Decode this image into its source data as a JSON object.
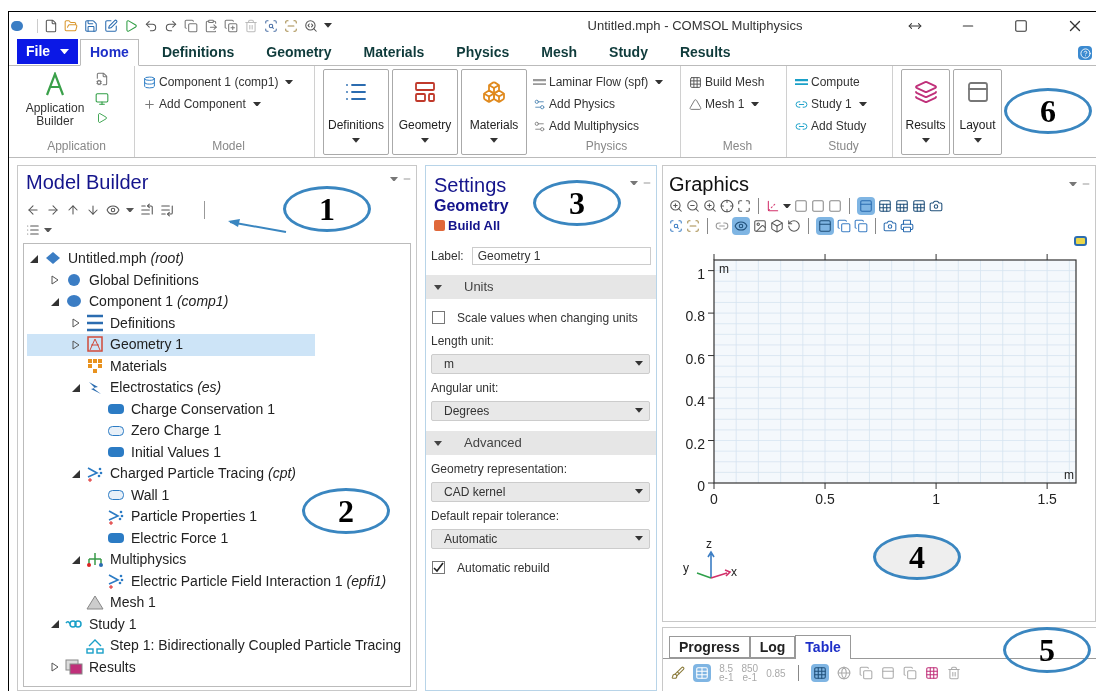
{
  "window": {
    "title": "Untitled.mph - COMSOL Multiphysics"
  },
  "ribbon_tabs": [
    {
      "label": "File",
      "kind": "file",
      "selected": false
    },
    {
      "label": "Home",
      "kind": "tab",
      "selected": true
    },
    {
      "label": "Definitions",
      "kind": "tab",
      "selected": false
    },
    {
      "label": "Geometry",
      "kind": "tab",
      "selected": false
    },
    {
      "label": "Materials",
      "kind": "tab",
      "selected": false
    },
    {
      "label": "Physics",
      "kind": "tab",
      "selected": false
    },
    {
      "label": "Mesh",
      "kind": "tab",
      "selected": false
    },
    {
      "label": "Study",
      "kind": "tab",
      "selected": false
    },
    {
      "label": "Results",
      "kind": "tab",
      "selected": false
    }
  ],
  "ribbon_groups": [
    {
      "caption": "Application",
      "items": [
        {
          "kind": "large",
          "label": "Application Builder",
          "dropdown": false
        },
        {
          "kind": "icons"
        }
      ]
    },
    {
      "caption": "Model",
      "items": [
        {
          "kind": "small",
          "label": "Component 1 (comp1)",
          "dropdown": true
        },
        {
          "kind": "small",
          "label": "Add Component",
          "dropdown": true
        }
      ]
    },
    {
      "items": [
        {
          "kind": "boxed",
          "label": "Definitions",
          "dropdown": true
        },
        {
          "kind": "boxed",
          "label": "Geometry",
          "dropdown": true
        },
        {
          "kind": "boxed",
          "label": "Materials",
          "dropdown": true
        }
      ]
    },
    {
      "caption": "Physics",
      "items": [
        {
          "kind": "small",
          "label": "Laminar Flow (spf)",
          "dropdown": true
        },
        {
          "kind": "small",
          "label": "Add Physics",
          "dropdown": false
        },
        {
          "kind": "small",
          "label": "Add Multiphysics",
          "dropdown": false
        }
      ]
    },
    {
      "caption": "Mesh",
      "items": [
        {
          "kind": "small",
          "label": "Build Mesh",
          "dropdown": false
        },
        {
          "kind": "small",
          "label": "Mesh 1",
          "dropdown": true
        }
      ]
    },
    {
      "caption": "Study",
      "items": [
        {
          "kind": "small",
          "label": "Compute",
          "dropdown": false
        },
        {
          "kind": "small",
          "label": "Study 1",
          "dropdown": true
        },
        {
          "kind": "small",
          "label": "Add Study",
          "dropdown": false
        }
      ]
    },
    {
      "items": [
        {
          "kind": "boxed",
          "label": "Results",
          "dropdown": true
        },
        {
          "kind": "boxed",
          "label": "Layout",
          "dropdown": true
        }
      ]
    }
  ],
  "model_builder": {
    "title": "Model Builder",
    "tree": [
      {
        "label": "Untitled.mph *(root)*",
        "expanded": true,
        "selected": false,
        "children": [
          {
            "label": "Global Definitions",
            "expanded": false,
            "selected": false
          },
          {
            "label": "Component 1 *(comp1)*",
            "expanded": true,
            "selected": false,
            "children": [
              {
                "label": "Definitions",
                "expanded": false,
                "selected": false
              },
              {
                "label": "Geometry 1",
                "expanded": false,
                "selected": true
              },
              {
                "label": "Materials",
                "selected": false
              },
              {
                "label": "Electrostatics *(es)*",
                "expanded": true,
                "selected": false,
                "children": [
                  {
                    "label": "Charge Conservation 1",
                    "selected": false
                  },
                  {
                    "label": "Zero Charge 1",
                    "selected": false
                  },
                  {
                    "label": "Initial Values 1",
                    "selected": false
                  }
                ]
              },
              {
                "label": "Charged Particle Tracing *(cpt)*",
                "expanded": true,
                "selected": false,
                "children": [
                  {
                    "label": "Wall 1",
                    "selected": false
                  },
                  {
                    "label": "Particle Properties 1",
                    "selected": false
                  },
                  {
                    "label": "Electric Force 1",
                    "selected": false
                  }
                ]
              },
              {
                "label": "Multiphysics",
                "expanded": true,
                "selected": false,
                "children": [
                  {
                    "label": "Electric Particle Field Interaction 1 *(epfi1)*",
                    "selected": false
                  }
                ]
              },
              {
                "label": "Mesh 1",
                "selected": false
              }
            ]
          },
          {
            "label": "Study 1",
            "expanded": true,
            "selected": false,
            "children": [
              {
                "label": "Step 1: Bidirectionally Coupled Particle Tracing",
                "selected": false
              }
            ]
          },
          {
            "label": "Results",
            "expanded": false,
            "selected": false
          }
        ]
      }
    ]
  },
  "settings": {
    "title": "Settings",
    "subtitle": "Geometry",
    "build_button": "Build All",
    "label_field": {
      "label": "Label:",
      "value": "Geometry 1"
    },
    "sections": [
      {
        "title": "Units",
        "expanded": true,
        "items": [
          {
            "kind": "checkbox",
            "label": "Scale values when changing units",
            "checked": false
          },
          {
            "kind": "select",
            "label": "Length unit:",
            "value": "m"
          },
          {
            "kind": "select",
            "label": "Angular unit:",
            "value": "Degrees"
          }
        ]
      },
      {
        "title": "Advanced",
        "expanded": true,
        "items": [
          {
            "kind": "select",
            "label": "Geometry representation:",
            "value": "CAD kernel"
          },
          {
            "kind": "select",
            "label": "Default repair tolerance:",
            "value": "Automatic"
          },
          {
            "kind": "checkbox",
            "label": "Automatic rebuild",
            "checked": true
          }
        ]
      }
    ]
  },
  "graphics": {
    "title": "Graphics",
    "chart_data": {
      "type": "line",
      "xlabel": "m",
      "ylabel": "m",
      "grid": true,
      "xlim": [
        0,
        1.63
      ],
      "ylim": [
        0,
        1.05
      ],
      "xticks": [
        0,
        0.5,
        1,
        1.5
      ],
      "yticks": [
        0,
        0.2,
        0.4,
        0.6,
        0.8,
        1
      ]
    },
    "axis_triad": [
      "z",
      "y",
      "x"
    ]
  },
  "bottom_panel": {
    "tabs": [
      {
        "label": "Progress",
        "selected": false
      },
      {
        "label": "Log",
        "selected": false
      },
      {
        "label": "Table",
        "selected": true
      }
    ],
    "number_formats": [
      {
        "lines": [
          "8.5",
          "e-1"
        ]
      },
      {
        "lines": [
          "850",
          "e-1"
        ]
      },
      {
        "lines": [
          "0.85"
        ]
      }
    ]
  },
  "annotations": [
    {
      "label": "1"
    },
    {
      "label": "2"
    },
    {
      "label": "3"
    },
    {
      "label": "4"
    },
    {
      "label": "5"
    },
    {
      "label": "6"
    }
  ]
}
